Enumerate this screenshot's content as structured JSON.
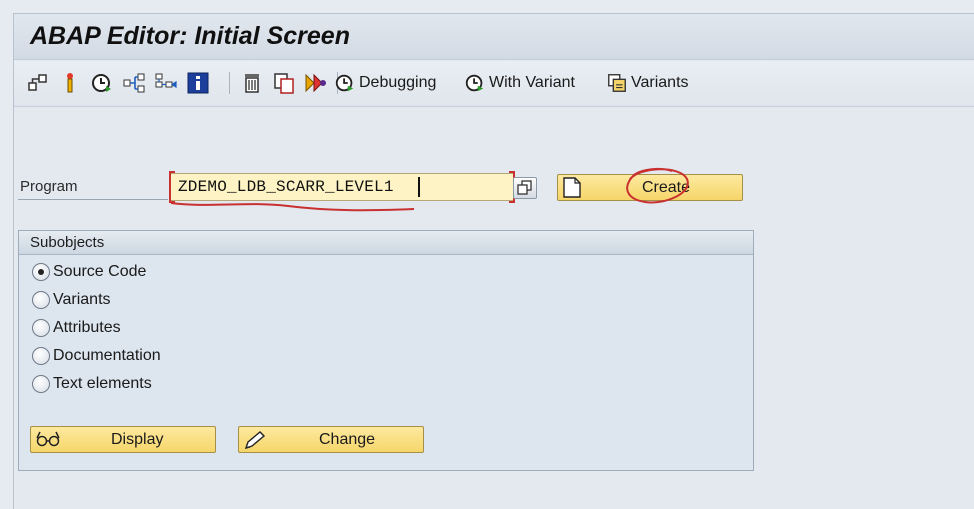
{
  "window": {
    "title": "ABAP Editor: Initial Screen"
  },
  "toolbar": {
    "icons": [
      "hierarchy-icon",
      "where-used-icon",
      "execute-icon",
      "navigate-icon",
      "object-list-icon",
      "info-icon",
      "delete-icon",
      "copy-icon",
      "rename-icon"
    ],
    "buttons": {
      "debugging": "Debugging",
      "with_variant": "With Variant",
      "variants": "Variants"
    }
  },
  "program": {
    "label": "Program",
    "value": "ZDEMO_LDB_SCARR_LEVEL1",
    "create_label": "Create"
  },
  "subobjects": {
    "title": "Subobjects",
    "options": [
      {
        "label": "Source Code",
        "selected": true
      },
      {
        "label": "Variants",
        "selected": false
      },
      {
        "label": "Attributes",
        "selected": false
      },
      {
        "label": "Documentation",
        "selected": false
      },
      {
        "label": "Text elements",
        "selected": false
      }
    ],
    "display_label": "Display",
    "change_label": "Change"
  },
  "colors": {
    "input_bg": "#fdf3c4",
    "button_bg": "#f6d66a",
    "annotation_red": "#c93030"
  }
}
